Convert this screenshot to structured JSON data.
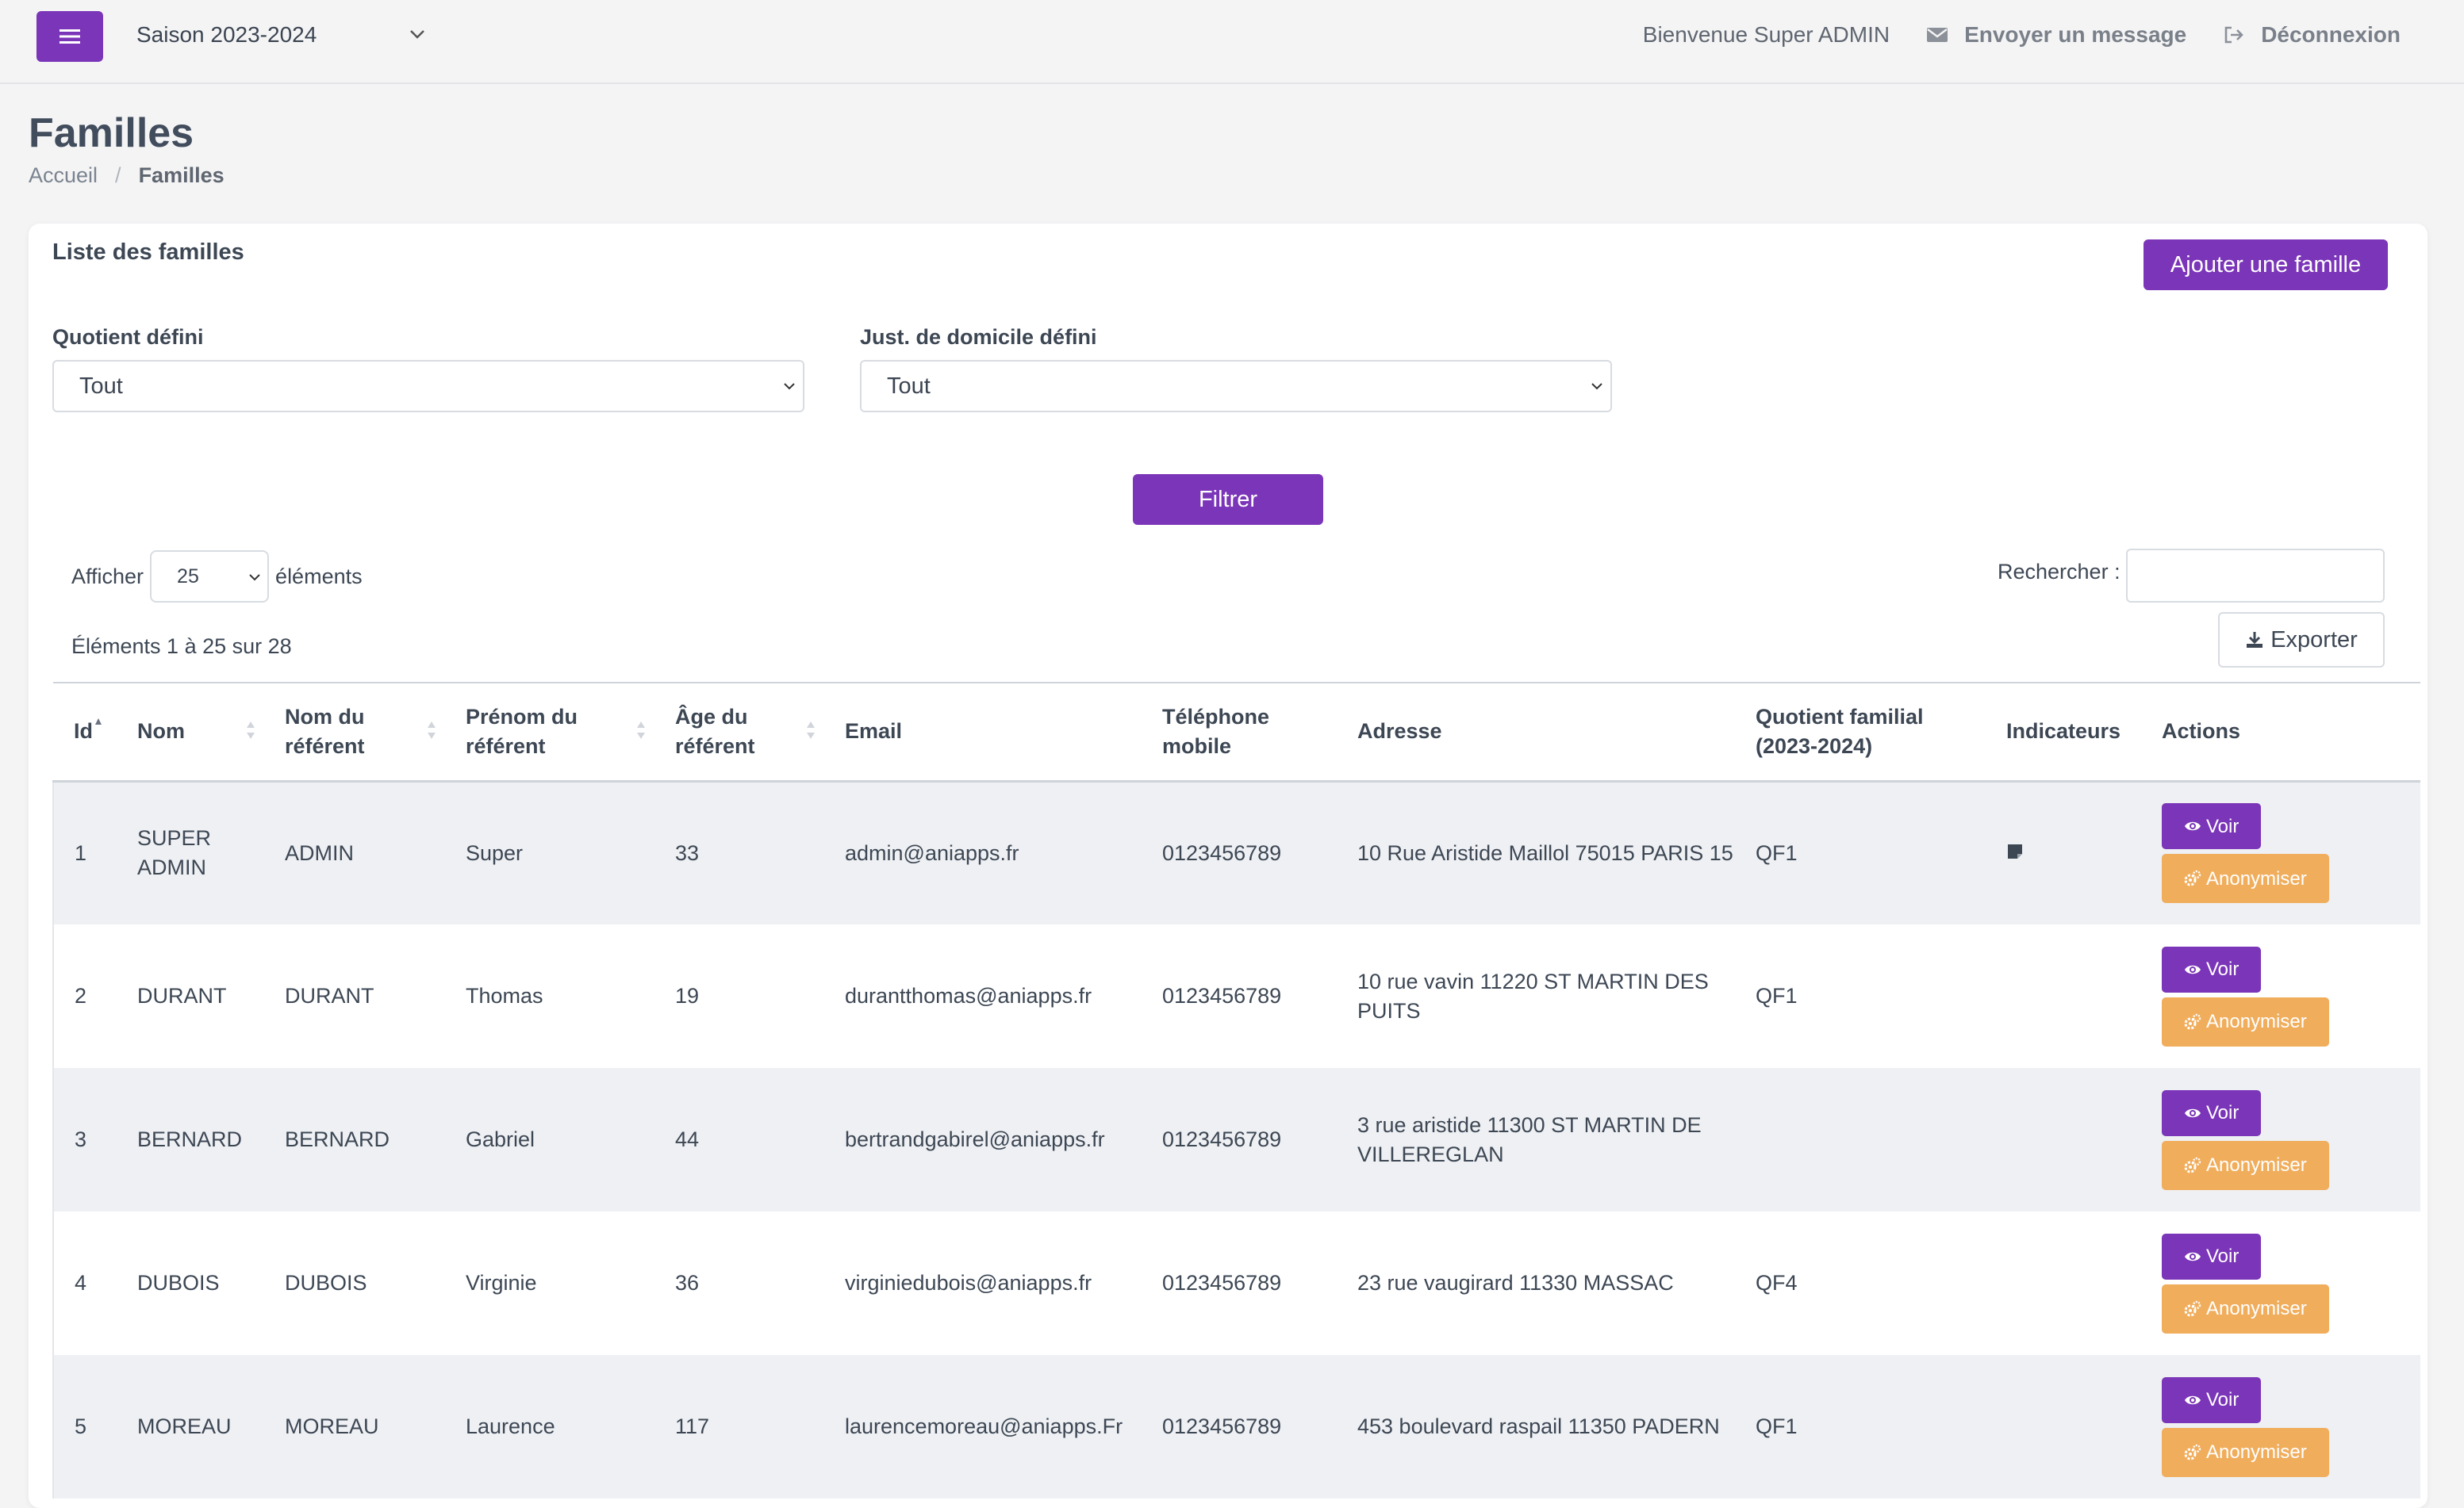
{
  "topbar": {
    "season": "Saison 2023-2024",
    "welcome": "Bienvenue Super ADMIN",
    "send_message": "Envoyer un message",
    "logout": "Déconnexion"
  },
  "page": {
    "title": "Familles",
    "breadcrumb": [
      "Accueil",
      "Familles"
    ]
  },
  "card": {
    "title": "Liste des familles",
    "add_button": "Ajouter une famille",
    "filters": [
      {
        "label": "Quotient défini",
        "value": "Tout"
      },
      {
        "label": "Just. de domicile défini",
        "value": "Tout"
      }
    ],
    "filter_button": "Filtrer",
    "show_prefix": "Afficher",
    "page_length": "25",
    "show_suffix": "éléments",
    "search_label": "Rechercher :",
    "search_value": "",
    "info": "Éléments 1 à 25 sur 28",
    "export_button": "Exporter"
  },
  "table": {
    "headers": [
      "Id",
      "Nom",
      "Nom du référent",
      "Prénom du référent",
      "Âge du référent",
      "Email",
      "Téléphone mobile",
      "Adresse",
      "Quotient familial (2023-2024)",
      "Indicateurs",
      "Actions"
    ],
    "action_view": "Voir",
    "action_anonymize": "Anonymiser",
    "rows": [
      {
        "id": "1",
        "nom": "SUPER ADMIN",
        "nom_ref": "ADMIN",
        "prenom": "Super",
        "age": "33",
        "email": "admin@aniapps.fr",
        "tel": "0123456789",
        "adresse": "10 Rue Aristide Maillol 75015 PARIS 15",
        "qf": "QF1",
        "indicator": "note-icon"
      },
      {
        "id": "2",
        "nom": "DURANT",
        "nom_ref": "DURANT",
        "prenom": "Thomas",
        "age": "19",
        "email": "durantthomas@aniapps.fr",
        "tel": "0123456789",
        "adresse": "10 rue vavin 11220 ST MARTIN DES PUITS",
        "qf": "QF1",
        "indicator": ""
      },
      {
        "id": "3",
        "nom": "BERNARD",
        "nom_ref": "BERNARD",
        "prenom": "Gabriel",
        "age": "44",
        "email": "bertrandgabirel@aniapps.fr",
        "tel": "0123456789",
        "adresse": "3 rue aristide 11300 ST MARTIN DE VILLEREGLAN",
        "qf": "",
        "indicator": ""
      },
      {
        "id": "4",
        "nom": "DUBOIS",
        "nom_ref": "DUBOIS",
        "prenom": "Virginie",
        "age": "36",
        "email": "virginiedubois@aniapps.fr",
        "tel": "0123456789",
        "adresse": "23 rue vaugirard 11330 MASSAC",
        "qf": "QF4",
        "indicator": ""
      },
      {
        "id": "5",
        "nom": "MOREAU",
        "nom_ref": "MOREAU",
        "prenom": "Laurence",
        "age": "117",
        "email": "laurencemoreau@aniapps.Fr",
        "tel": "0123456789",
        "adresse": "453 boulevard raspail 11350 PADERN",
        "qf": "QF1",
        "indicator": ""
      }
    ]
  },
  "colors": {
    "primary": "#7b35b8",
    "warning": "#f0ad5c",
    "row_stripe": "#eef0f3"
  }
}
